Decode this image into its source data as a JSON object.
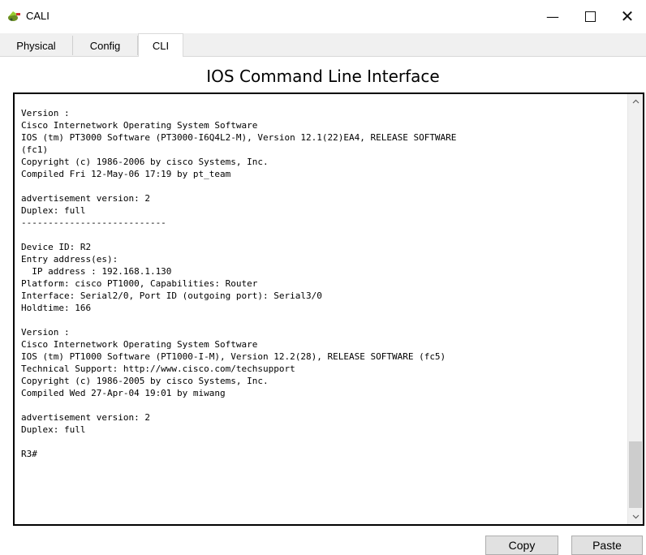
{
  "window": {
    "title": "CALI",
    "app_icon": "cisco-device-icon"
  },
  "window_controls": {
    "minimize": "—",
    "close": "✕"
  },
  "tabs": [
    {
      "label": "Physical"
    },
    {
      "label": "Config"
    },
    {
      "label": "CLI",
      "active": true
    }
  ],
  "heading": "IOS Command Line Interface",
  "console": {
    "text": "Version :\nCisco Internetwork Operating System Software\nIOS (tm) PT3000 Software (PT3000-I6Q4L2-M), Version 12.1(22)EA4, RELEASE SOFTWARE\n(fc1)\nCopyright (c) 1986-2006 by cisco Systems, Inc.\nCompiled Fri 12-May-06 17:19 by pt_team\n\nadvertisement version: 2\nDuplex: full\n---------------------------\n\nDevice ID: R2\nEntry address(es):\n  IP address : 192.168.1.130\nPlatform: cisco PT1000, Capabilities: Router\nInterface: Serial2/0, Port ID (outgoing port): Serial3/0\nHoldtime: 166\n\nVersion :\nCisco Internetwork Operating System Software\nIOS (tm) PT1000 Software (PT1000-I-M), Version 12.2(28), RELEASE SOFTWARE (fc5)\nTechnical Support: http://www.cisco.com/techsupport\nCopyright (c) 1986-2005 by cisco Systems, Inc.\nCompiled Wed 27-Apr-04 19:01 by miwang\n\nadvertisement version: 2\nDuplex: full\n\nR3#",
    "scroll_position": 0.95
  },
  "buttons": {
    "copy": "Copy",
    "paste": "Paste"
  }
}
